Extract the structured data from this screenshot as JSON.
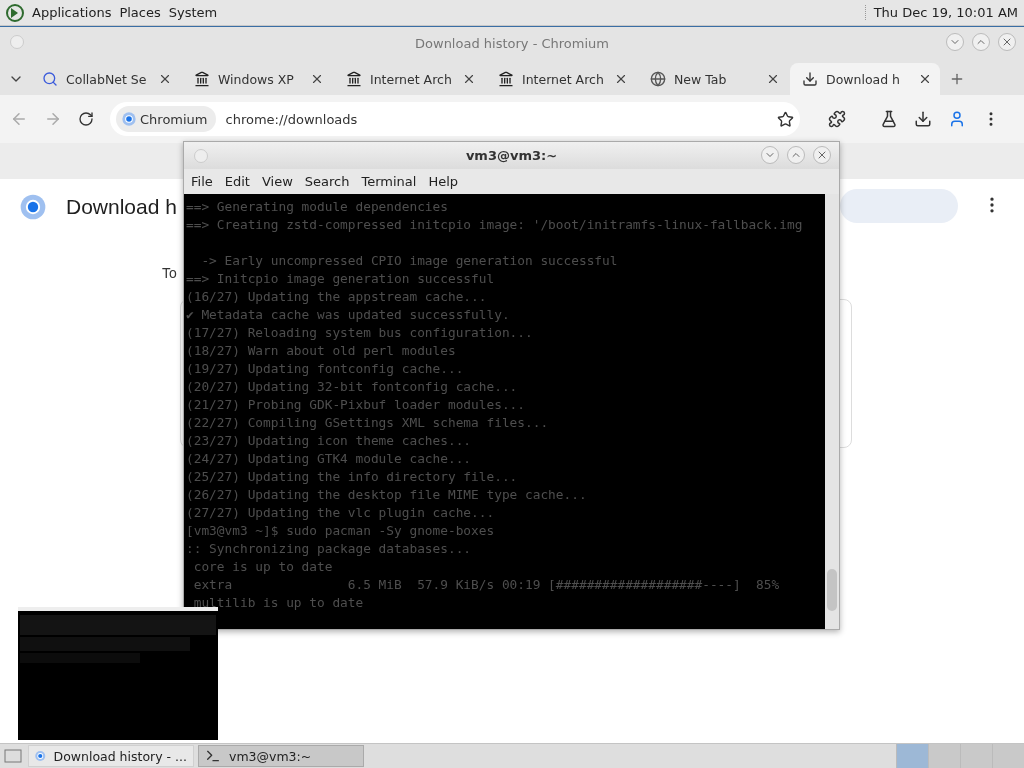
{
  "top_panel": {
    "menus": [
      "Applications",
      "Places",
      "System"
    ],
    "clock": "Thu Dec 19, 10:01 AM"
  },
  "browser": {
    "title": "Download history - Chromium",
    "tabs": [
      {
        "label": "CollabNet Se",
        "kind": "search",
        "selected": false
      },
      {
        "label": "Windows XP",
        "kind": "archive",
        "selected": false
      },
      {
        "label": "Internet Arch",
        "kind": "archive",
        "selected": false
      },
      {
        "label": "Internet Arch",
        "kind": "archive",
        "selected": false
      },
      {
        "label": "New Tab",
        "kind": "globe",
        "selected": false
      },
      {
        "label": "Download h",
        "kind": "download",
        "selected": true
      }
    ],
    "omnibox": {
      "chip": "Chromium",
      "url": "chrome://downloads"
    },
    "page": {
      "title": "Download h",
      "subtitle": "To"
    }
  },
  "terminal": {
    "title": "vm3@vm3:~",
    "menu": [
      "File",
      "Edit",
      "View",
      "Search",
      "Terminal",
      "Help"
    ],
    "blocks": [
      [
        "==> Generating module dependencies",
        "==> Creating zstd-compressed initcpio image: '/boot/initramfs-linux-fallback.img"
      ],
      [
        "  -> Early uncompressed CPIO image generation successful",
        "==> Initcpio image generation successful",
        "(16/27) Updating the appstream cache...",
        "✔ Metadata cache was updated successfully.",
        "(17/27) Reloading system bus configuration...",
        "(18/27) Warn about old perl modules",
        "(19/27) Updating fontconfig cache...",
        "(20/27) Updating 32-bit fontconfig cache...",
        "(21/27) Probing GDK-Pixbuf loader modules...",
        "(22/27) Compiling GSettings XML schema files...",
        "(23/27) Updating icon theme caches...",
        "(24/27) Updating GTK4 module cache...",
        "(25/27) Updating the info directory file...",
        "(26/27) Updating the desktop file MIME type cache...",
        "(27/27) Updating the vlc plugin cache...",
        "[vm3@vm3 ~]$ sudo pacman -Sy gnome-boxes",
        ":: Synchronizing package databases...",
        " core is up to date",
        " extra               6.5 MiB  57.9 KiB/s 00:19 [###################----]  85%",
        " multilib is up to date"
      ]
    ]
  },
  "taskbar": {
    "tasks": [
      {
        "label": "Download history - ...",
        "kind": "browser",
        "selected": false
      },
      {
        "label": "vm3@vm3:~",
        "kind": "terminal",
        "selected": true
      }
    ],
    "workspaces": [
      {
        "selected": true
      },
      {
        "selected": false
      },
      {
        "selected": false
      },
      {
        "selected": false
      }
    ]
  }
}
